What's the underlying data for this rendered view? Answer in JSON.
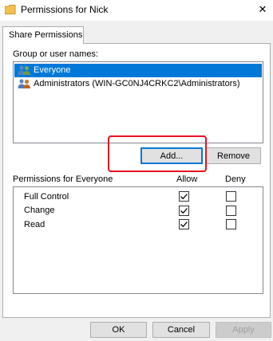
{
  "window": {
    "title": "Permissions for Nick",
    "close_glyph": "✕",
    "icon": "folder-icon"
  },
  "tab": {
    "label": "Share Permissions"
  },
  "users": {
    "label": "Group or user names:",
    "items": [
      {
        "name": "Everyone",
        "icon": "users-group-icon",
        "selected": true
      },
      {
        "name": "Administrators (WIN-GC0NJ4CRKC2\\Administrators)",
        "icon": "users-group-icon",
        "selected": false
      }
    ]
  },
  "buttons": {
    "add": "Add...",
    "remove": "Remove",
    "ok": "OK",
    "cancel": "Cancel",
    "apply": "Apply"
  },
  "permissions": {
    "label": "Permissions for Everyone",
    "allow_header": "Allow",
    "deny_header": "Deny",
    "rows": [
      {
        "name": "Full Control",
        "allow": true,
        "deny": false
      },
      {
        "name": "Change",
        "allow": true,
        "deny": false
      },
      {
        "name": "Read",
        "allow": true,
        "deny": false
      }
    ]
  },
  "colors": {
    "selection": "#0078d7",
    "highlight": "#e81123",
    "folder": "#e8b93a"
  }
}
